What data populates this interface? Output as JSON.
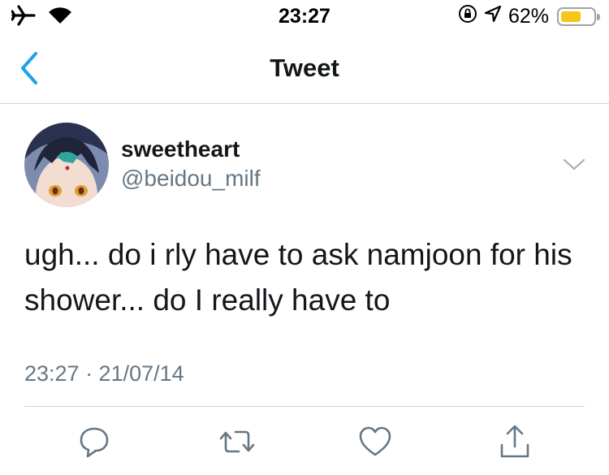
{
  "status_bar": {
    "time": "23:27",
    "battery_percent_label": "62%",
    "battery_level": 0.62,
    "icons": [
      "airplane-icon",
      "wifi-icon",
      "rotation-lock-icon",
      "location-icon",
      "battery-icon"
    ]
  },
  "nav": {
    "title": "Tweet",
    "back_icon": "chevron-left-icon"
  },
  "tweet": {
    "display_name": "sweetheart",
    "handle": "@beidou_milf",
    "text": "ugh... do i rly have to ask namjoon for his shower... do I really have to",
    "timestamp": "23:27 · 21/07/14",
    "more_icon": "chevron-down-icon"
  },
  "actions": [
    "reply-icon",
    "retweet-icon",
    "like-icon",
    "share-icon"
  ],
  "colors": {
    "accent": "#1da1f2",
    "secondary_text": "#657786",
    "primary_text": "#14171a",
    "battery": "#f5c518",
    "divider": "#cfd4d9"
  }
}
